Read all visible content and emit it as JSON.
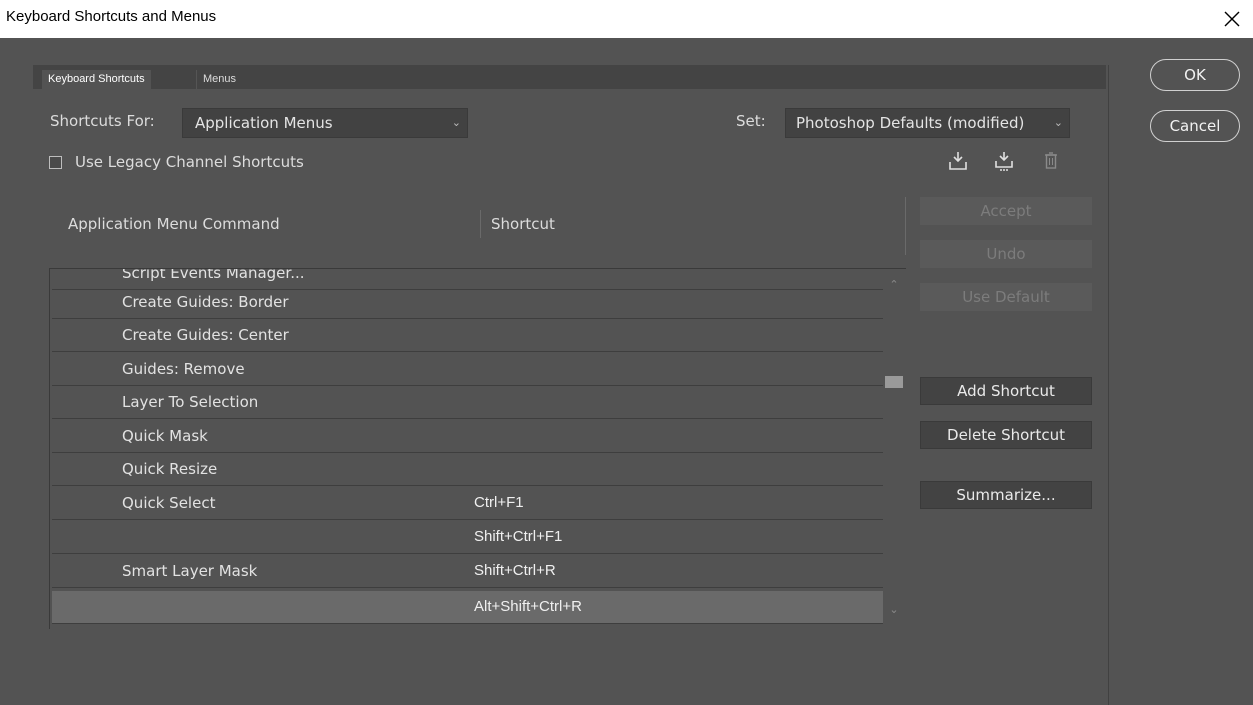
{
  "window": {
    "title": "Keyboard Shortcuts and Menus"
  },
  "tabs": [
    {
      "label": "Keyboard Shortcuts",
      "active": true
    },
    {
      "label": "Menus",
      "active": false
    }
  ],
  "shortcuts_for": {
    "label": "Shortcuts For:",
    "value": "Application Menus"
  },
  "set": {
    "label": "Set:",
    "value": "Photoshop Defaults (modified)"
  },
  "legacy": {
    "label": "Use Legacy Channel Shortcuts",
    "checked": false
  },
  "set_icons": [
    "save-set-icon",
    "save-as-set-icon",
    "delete-set-icon"
  ],
  "columns": {
    "command": "Application Menu Command",
    "shortcut": "Shortcut"
  },
  "rows": [
    {
      "command": "Script Events Manager...",
      "shortcut": ""
    },
    {
      "command": "Create Guides: Border",
      "shortcut": ""
    },
    {
      "command": "Create Guides: Center",
      "shortcut": ""
    },
    {
      "command": "Guides: Remove",
      "shortcut": ""
    },
    {
      "command": "Layer To Selection",
      "shortcut": ""
    },
    {
      "command": "Quick Mask",
      "shortcut": ""
    },
    {
      "command": "Quick Resize",
      "shortcut": ""
    },
    {
      "command": "Quick Select",
      "shortcut": "Ctrl+F1"
    },
    {
      "command": "",
      "shortcut": "Shift+Ctrl+F1"
    },
    {
      "command": "Smart Layer Mask",
      "shortcut": "Shift+Ctrl+R"
    },
    {
      "command": "",
      "shortcut": "Alt+Shift+Ctrl+R",
      "selected": true
    }
  ],
  "side_buttons": {
    "accept": "Accept",
    "undo": "Undo",
    "use_default": "Use Default",
    "add_shortcut": "Add Shortcut",
    "delete_shortcut": "Delete Shortcut",
    "summarize": "Summarize..."
  },
  "dialog_buttons": {
    "ok": "OK",
    "cancel": "Cancel"
  },
  "colors": {
    "background": "#535353",
    "selected_row": "#6a6a6a",
    "titlebar": "#ffffff"
  }
}
